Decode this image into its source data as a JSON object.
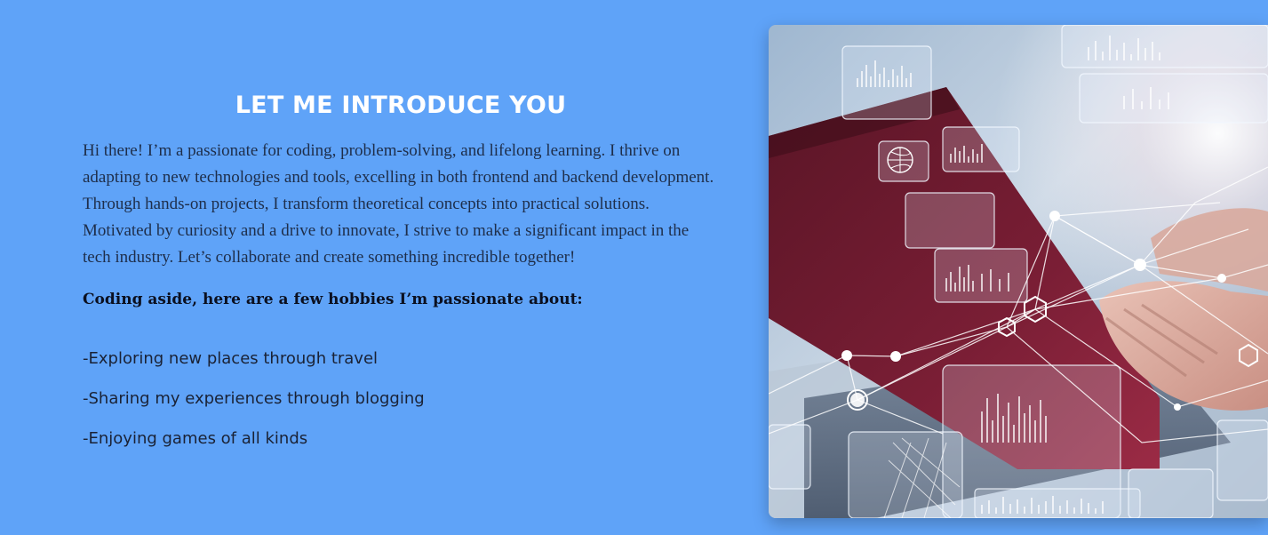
{
  "intro": {
    "title": "LET ME INTRODUCE YOU",
    "body": "Hi there! I’m a passionate for coding, problem-solving, and lifelong learning. I thrive on adapting to new technologies and tools, excelling in both frontend and backend development. Through hands-on projects, I transform theoretical concepts into practical solutions. Motivated by curiosity and a drive to innovate, I strive to make a significant impact in the tech industry. Let’s collaborate and create something incredible together!",
    "hobbies_heading": "Coding aside, here are a few hobbies I’m passionate about:",
    "hobbies": [
      "-Exploring new places through travel",
      "-Sharing my experiences through blogging",
      "-Enjoying games of all kinds"
    ]
  },
  "colors": {
    "page_background": "#5fa3f8",
    "title_text": "#ffffff",
    "body_text": "#1e2e4a"
  },
  "hero_image": {
    "subject": "hands-typing-on-laptop-with-holographic-data-network"
  }
}
